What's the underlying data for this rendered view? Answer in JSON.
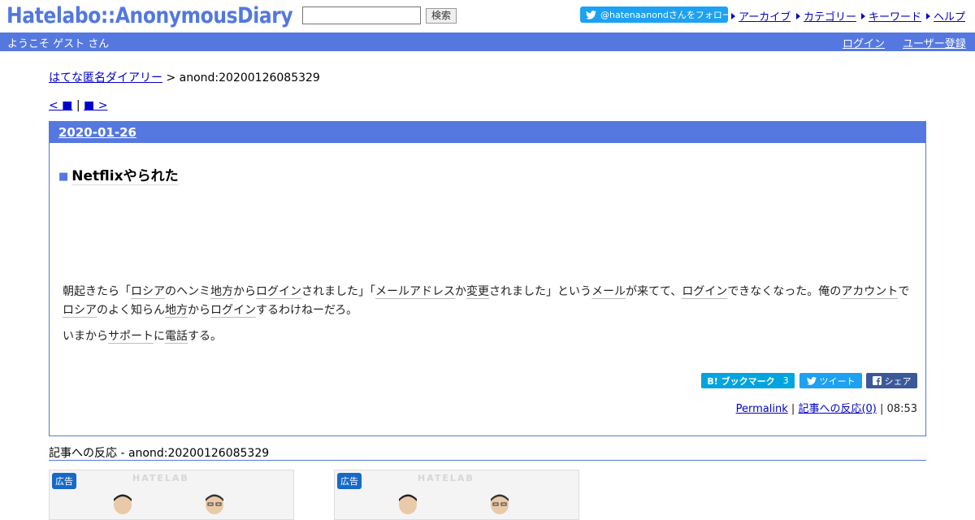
{
  "header": {
    "logo": "Hatelabo::AnonymousDiary",
    "search_placeholder": "",
    "search_button": "検索",
    "follow_label": "@hatenaanondさんをフォロー",
    "nav": [
      {
        "label": "アーカイブ"
      },
      {
        "label": "カテゴリー"
      },
      {
        "label": "キーワード"
      },
      {
        "label": "ヘルプ"
      }
    ]
  },
  "bar": {
    "welcome": "ようこそ ゲスト さん",
    "login": "ログイン",
    "register": "ユーザー登録"
  },
  "breadcrumb": {
    "home": "はてな匿名ダイアリー",
    "separator": ">",
    "current": "anond:20200126085329"
  },
  "pager": {
    "prev": "< ■",
    "separator": "|",
    "next": "■ >"
  },
  "entry": {
    "date": "2020-01-26",
    "title_marker": "■",
    "title": "Netflixやられた",
    "p1": [
      {
        "t": "朝起きたら「"
      },
      {
        "t": "ロシア",
        "kw": true
      },
      {
        "t": "のヘンミ"
      },
      {
        "t": "地方",
        "kw": true
      },
      {
        "t": "から"
      },
      {
        "t": "ログイン",
        "kw": true
      },
      {
        "t": "されました」「"
      },
      {
        "t": "メールアドレス",
        "kw": true
      },
      {
        "t": "か"
      },
      {
        "t": "変更",
        "kw": true
      },
      {
        "t": "されました」という"
      },
      {
        "t": "メール",
        "kw": true
      },
      {
        "t": "が来てて、"
      },
      {
        "t": "ログイン",
        "kw": true
      },
      {
        "t": "できなくなった。俺の"
      },
      {
        "t": "アカウント",
        "kw": true
      },
      {
        "t": "で"
      },
      {
        "t": "ロシア",
        "kw": true
      },
      {
        "t": "のよく知らん"
      },
      {
        "t": "地方",
        "kw": true
      },
      {
        "t": "から"
      },
      {
        "t": "ログイン",
        "kw": true
      },
      {
        "t": "するわけねーだろ。"
      }
    ],
    "p2": [
      {
        "t": "いまから"
      },
      {
        "t": "サポート",
        "kw": true
      },
      {
        "t": "に"
      },
      {
        "t": "電話",
        "kw": true
      },
      {
        "t": "する。"
      }
    ],
    "share": {
      "bookmark_label": "B! ブックマーク",
      "bookmark_count": "3",
      "tweet_label": "ツイート",
      "share_label": "シェア"
    },
    "footer": {
      "permalink": "Permalink",
      "reactions": "記事への反応(0)",
      "time": "08:53",
      "separator": "|"
    }
  },
  "reactions": {
    "heading": "記事への反応 - anond:20200126085329"
  },
  "ads": [
    {
      "badge": "広告",
      "watermark": "HATELAB"
    },
    {
      "badge": "広告",
      "watermark": "HATELAB"
    }
  ],
  "colors": {
    "accent": "#5578e0",
    "link": "#0000cc",
    "twitter": "#1da1f2",
    "hatena": "#00a4de",
    "facebook": "#3b5998"
  }
}
